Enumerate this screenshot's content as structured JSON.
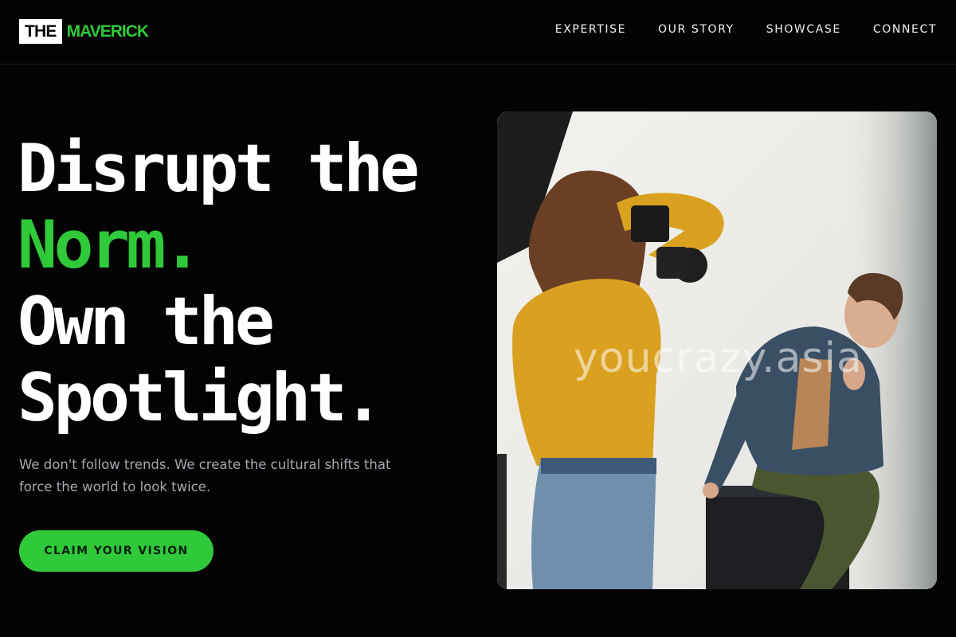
{
  "brand": {
    "logo_box_text": "THE",
    "logo_word": "MAVERICK",
    "accent_color": "#2fc93a"
  },
  "nav": {
    "items": [
      {
        "label": "EXPERTISE"
      },
      {
        "label": "OUR STORY"
      },
      {
        "label": "SHOWCASE"
      },
      {
        "label": "CONNECT"
      }
    ]
  },
  "hero": {
    "headline_line1": "Disrupt the",
    "headline_line2": "Norm.",
    "headline_line3": "Own the",
    "headline_line4": "Spotlight.",
    "subtitle": "We don't follow trends. We create the cultural shifts that force the world to look twice.",
    "cta_label": "CLAIM YOUR VISION",
    "image_watermark": "youcrazy.asia"
  },
  "colors": {
    "background": "#030303",
    "text": "#ffffff",
    "subtitle": "#a4a8b0",
    "accent": "#2fc93a"
  }
}
